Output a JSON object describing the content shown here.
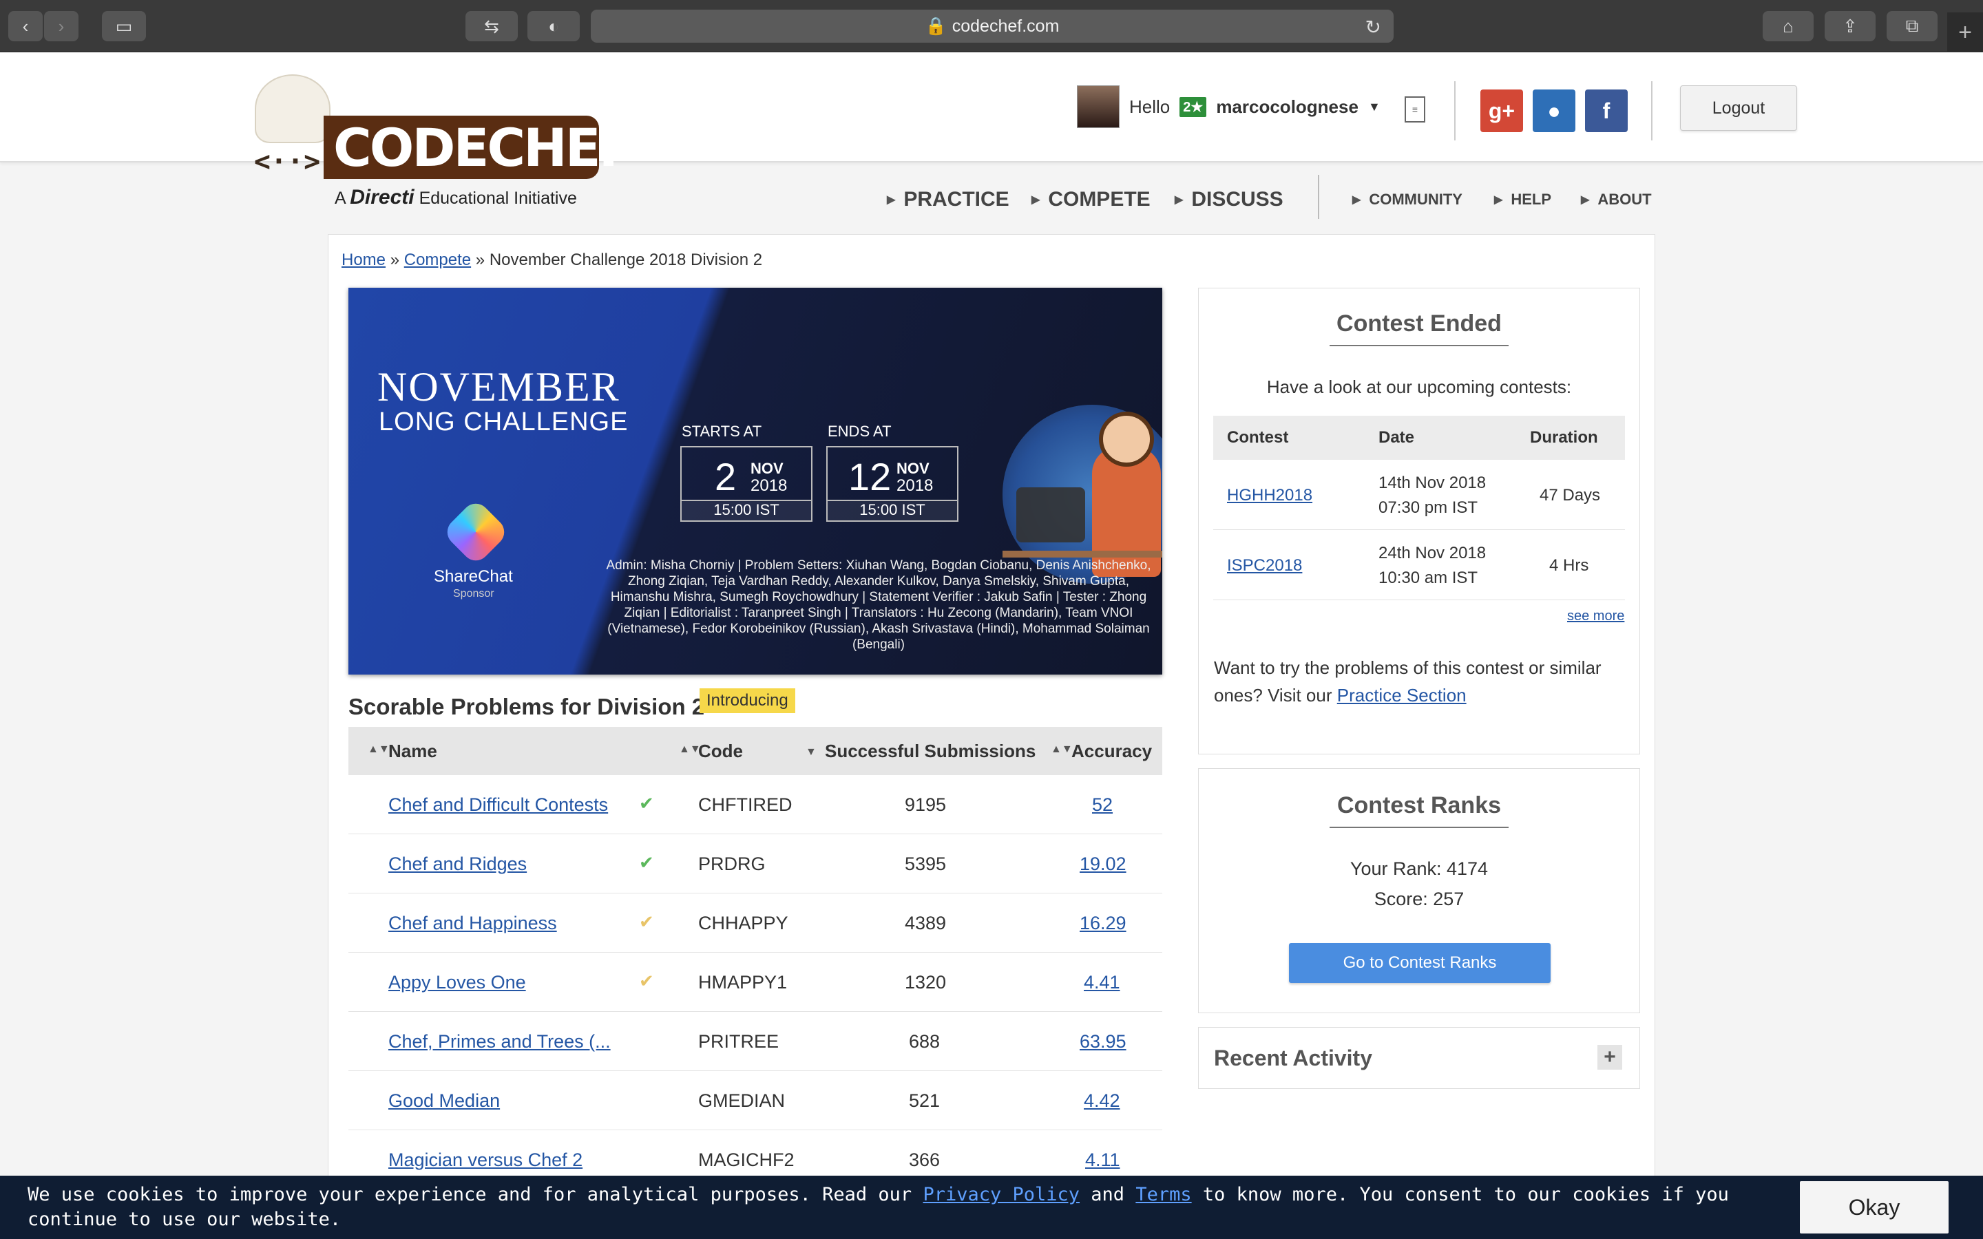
{
  "browser": {
    "url": "codechef.com",
    "icons": [
      "back-icon",
      "forward-icon",
      "sidebar-icon",
      "history-icon",
      "privacy-icon",
      "lock-icon",
      "reload-icon",
      "home-icon",
      "share-icon",
      "tabs-icon",
      "new-tab-icon"
    ]
  },
  "header": {
    "logo_text": "CODECHEF",
    "logo_face": "<··>",
    "tagline_a": "A",
    "tagline_brand": "Directi",
    "tagline_rest": "Educational Initiative",
    "hello": "Hello",
    "star_badge": "2★",
    "username": "marcocolognese",
    "social": [
      "g+",
      "github",
      "f"
    ],
    "social_letters": [
      "g+",
      "●",
      "f"
    ],
    "logout": "Logout",
    "nav_main": [
      "PRACTICE",
      "COMPETE",
      "DISCUSS"
    ],
    "nav_small": [
      "COMMUNITY",
      "HELP",
      "ABOUT"
    ]
  },
  "breadcrumb": {
    "home": "Home",
    "sep": "»",
    "compete": "Compete",
    "current": "November Challenge 2018 Division 2"
  },
  "banner": {
    "title1": "NOVEMBER",
    "title2": "LONG CHALLENGE",
    "sponsor": "ShareChat",
    "sponsor_sub": "Sponsor",
    "starts_label": "STARTS AT",
    "ends_label": "ENDS AT",
    "start_day": "2",
    "end_day": "12",
    "month": "NOV",
    "year": "2018",
    "time": "15:00 IST",
    "credits": "Admin: Misha Chorniy | Problem Setters: Xiuhan Wang, Bogdan Ciobanu, Denis Anishchenko, Zhong Ziqian, Teja Vardhan Reddy, Alexander Kulkov, Danya Smelskiy, Shivam Gupta, Himanshu Mishra, Sumegh Roychowdhury | Statement Verifier : Jakub Safin | Tester : Zhong Ziqian | Editorialist : Taranpreet Singh | Translators : Hu Zecong (Mandarin), Team VNOI (Vietnamese), Fedor Korobeinikov (Russian), Akash Srivastava (Hindi), Mohammad Solaiman (Bengali)"
  },
  "problems": {
    "title": "Scorable Problems for Division 2",
    "badge": "Introducing",
    "columns": [
      "Name",
      "Code",
      "Successful Submissions",
      "Accuracy"
    ],
    "rows": [
      {
        "name": "Chef and Difficult Contests",
        "status": "solved",
        "code": "CHFTIRED",
        "submissions": "9195",
        "accuracy": "52"
      },
      {
        "name": "Chef and Ridges",
        "status": "solved",
        "code": "PRDRG",
        "submissions": "5395",
        "accuracy": "19.02"
      },
      {
        "name": "Chef and Happiness",
        "status": "partial",
        "code": "CHHAPPY",
        "submissions": "4389",
        "accuracy": "16.29"
      },
      {
        "name": "Appy Loves One",
        "status": "partial",
        "code": "HMAPPY1",
        "submissions": "1320",
        "accuracy": "4.41"
      },
      {
        "name": "Chef, Primes and Trees (...",
        "status": "",
        "code": "PRITREE",
        "submissions": "688",
        "accuracy": "63.95"
      },
      {
        "name": "Good Median",
        "status": "",
        "code": "GMEDIAN",
        "submissions": "521",
        "accuracy": "4.42"
      },
      {
        "name": "Magician versus Chef 2",
        "status": "",
        "code": "MAGICHF2",
        "submissions": "366",
        "accuracy": "4.11"
      }
    ],
    "colors": {
      "solved": "#5cb85c",
      "partial": "#e8c468"
    }
  },
  "sidebar": {
    "ended_title": "Contest Ended",
    "ended_text": "Have a look at our upcoming contests:",
    "upcoming_columns": [
      "Contest",
      "Date",
      "Duration"
    ],
    "upcoming": [
      {
        "contest": "HGHH2018",
        "date1": "14th Nov 2018",
        "date2": "07:30 pm IST",
        "duration": "47 Days"
      },
      {
        "contest": "ISPC2018",
        "date1": "24th Nov 2018",
        "date2": "10:30 am IST",
        "duration": "4 Hrs"
      }
    ],
    "see_more": "see more",
    "try_text_1": "Want to try the problems of this contest or similar",
    "try_text_2": "ones? Visit our",
    "practice_link": "Practice Section",
    "ranks_title": "Contest Ranks",
    "your_rank": "Your Rank: 4174",
    "score": "Score: 257",
    "ranks_button": "Go to Contest Ranks",
    "recent_title": "Recent Activity",
    "recent_toggle": "+"
  },
  "cookie": {
    "text_1": "We use cookies to improve your experience and for analytical purposes. Read our",
    "privacy": "Privacy Policy",
    "and": "and",
    "terms": "Terms",
    "text_2": "to know more. You consent to our cookies if you continue to use our website.",
    "okay": "Okay"
  },
  "colors": {
    "accent": "#2456a4",
    "button": "#4a8de0",
    "cookie_bg": "#0f1d33"
  }
}
